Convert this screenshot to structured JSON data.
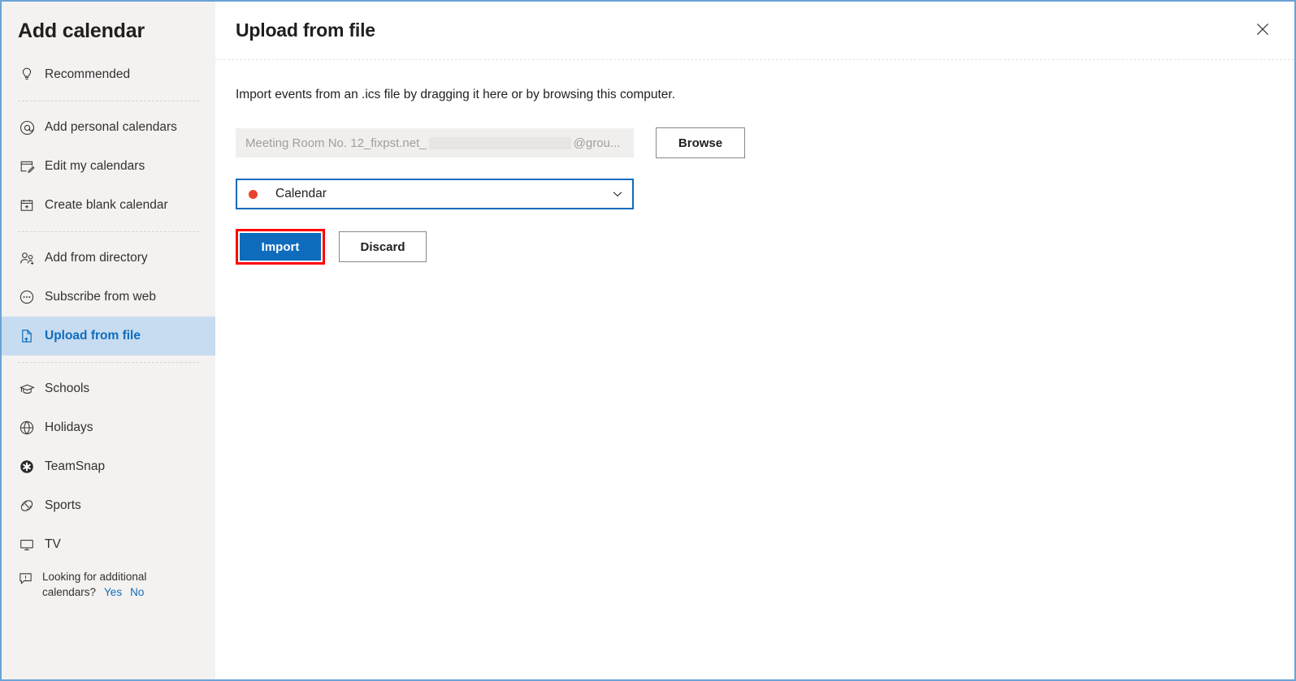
{
  "window": {
    "frame_border_color": "#6ba3d6"
  },
  "sidebar": {
    "title": "Add calendar",
    "groups": [
      {
        "items": [
          {
            "label": "Recommended",
            "icon": "lightbulb-icon",
            "selected": false
          }
        ]
      },
      {
        "items": [
          {
            "label": "Add personal calendars",
            "icon": "at-sign-icon",
            "selected": false
          },
          {
            "label": "Edit my calendars",
            "icon": "edit-calendar-icon",
            "selected": false
          },
          {
            "label": "Create blank calendar",
            "icon": "calendar-plus-icon",
            "selected": false
          }
        ]
      },
      {
        "items": [
          {
            "label": "Add from directory",
            "icon": "person-add-icon",
            "selected": false
          },
          {
            "label": "Subscribe from web",
            "icon": "ellipsis-circle-icon",
            "selected": false
          },
          {
            "label": "Upload from file",
            "icon": "file-upload-icon",
            "selected": true
          }
        ]
      },
      {
        "items": [
          {
            "label": "Schools",
            "icon": "graduation-cap-icon",
            "selected": false
          },
          {
            "label": "Holidays",
            "icon": "globe-icon",
            "selected": false
          },
          {
            "label": "TeamSnap",
            "icon": "teamsnap-asterisk-icon",
            "selected": false
          },
          {
            "label": "Sports",
            "icon": "sports-ball-icon",
            "selected": false
          },
          {
            "label": "TV",
            "icon": "monitor-icon",
            "selected": false
          }
        ]
      }
    ],
    "footer": {
      "icon": "feedback-comment-icon",
      "prompt": "Looking for additional calendars?",
      "yes_label": "Yes",
      "no_label": "No",
      "link_color": "#0f6cbd"
    },
    "selected_background": "#c7dcf0",
    "selected_text_color": "#0f6cbd",
    "background": "#f3f2f1"
  },
  "main": {
    "title": "Upload from file",
    "close_icon": "close-icon",
    "instructions": "Import events from an .ics file by dragging it here or by browsing this computer.",
    "file_field": {
      "value_prefix": "Meeting Room No. 12_fixpst.net_",
      "value_suffix": "@grou...",
      "redacted": true
    },
    "browse_label": "Browse",
    "calendar_select": {
      "selected": "Calendar",
      "dot_color": "#e8442b",
      "chevron_icon": "chevron-down-icon",
      "focus_border_color": "#0f6cbd"
    },
    "import_label": "Import",
    "discard_label": "Discard",
    "highlight_color": "#ff0000",
    "primary_color": "#0f6cbd"
  }
}
